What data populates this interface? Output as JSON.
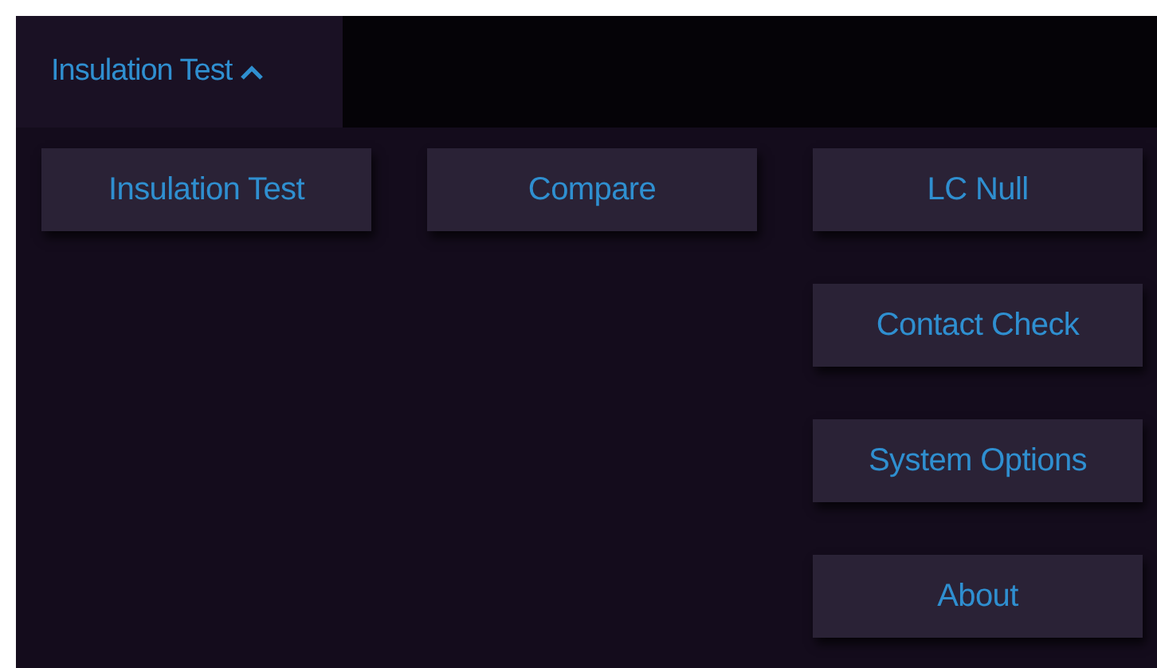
{
  "tab": {
    "label": "Insulation Test",
    "expanded": true
  },
  "buttons": [
    {
      "label": "Insulation Test"
    },
    {
      "label": "Compare"
    },
    {
      "label": "LC Null"
    },
    {
      "label": "Contact Check"
    },
    {
      "label": "System Options"
    },
    {
      "label": "About"
    }
  ]
}
